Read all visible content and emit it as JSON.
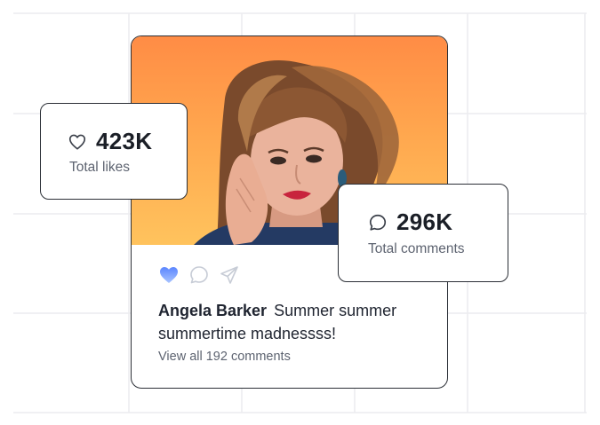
{
  "post": {
    "author": "Angela Barker",
    "caption": "Summer summer summertime madnessss!",
    "view_comments": "View all 192 comments"
  },
  "stats": {
    "likes": {
      "value": "423K",
      "label": "Total likes",
      "icon": "heart-icon"
    },
    "comments": {
      "value": "296K",
      "label": "Total comments",
      "icon": "comment-icon"
    }
  },
  "actions": [
    {
      "icon": "heart-filled-icon",
      "color": "#6f9cff"
    },
    {
      "icon": "comment-icon"
    },
    {
      "icon": "send-icon"
    }
  ],
  "colors": {
    "photo_gradient_top": "#ff8c45",
    "photo_gradient_bottom": "#ffc35d",
    "like_active": "#6f9cff",
    "border": "#2b2f36"
  }
}
